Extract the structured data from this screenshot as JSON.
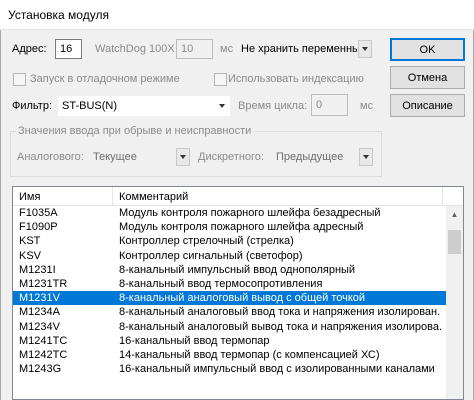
{
  "window": {
    "title": "Установка модуля"
  },
  "address": {
    "label": "Адрес:",
    "value": "16"
  },
  "watchdog": {
    "label": "WatchDog 100X",
    "value": "10",
    "unit": "мс"
  },
  "storage": {
    "value": "Не хранить переменны"
  },
  "debug": {
    "label": "Запуск в отладочном режиме"
  },
  "indexing": {
    "label": "Использовать индексацию"
  },
  "filter": {
    "label": "Фильтр:",
    "value": "ST-BUS(N)"
  },
  "cycle": {
    "label": "Время цикла:",
    "value": "0",
    "unit": "мс"
  },
  "fault_group": {
    "title": "Значения ввода при обрыве и неисправности",
    "analog_label": "Аналогового:",
    "analog_value": "Текущее",
    "discrete_label": "Дискретного:",
    "discrete_value": "Предыдущее"
  },
  "buttons": {
    "ok": "OK",
    "cancel": "Отмена",
    "description": "Описание"
  },
  "list": {
    "columns": [
      "Имя",
      "Комментарий"
    ],
    "rows": [
      {
        "name": "F1035A",
        "comment": "Модуль контроля пожарного шлейфа безадресный"
      },
      {
        "name": "F1090P",
        "comment": "Модуль контроля пожарного шлейфа адресный"
      },
      {
        "name": "KST",
        "comment": "Контроллер стрелочный (стрелка)"
      },
      {
        "name": "KSV",
        "comment": "Контроллер сигнальный (светофор)"
      },
      {
        "name": "M1231I",
        "comment": "8-канальный импульсный ввод однополярный"
      },
      {
        "name": "M1231TR",
        "comment": "8-канальный ввод термосопротивления"
      },
      {
        "name": "M1231V",
        "comment": "8-канальный аналоговый вывод с общей точкой"
      },
      {
        "name": "M1234A",
        "comment": "8-канальный аналоговый ввод тока и напряжения изолирован."
      },
      {
        "name": "M1234V",
        "comment": "8-канальный аналоговый вывод тока и напряжения изолирова."
      },
      {
        "name": "M1241TC",
        "comment": "16-канальный ввод термопар"
      },
      {
        "name": "M1242TC",
        "comment": "14-канальный ввод термопар (с компенсацией ХС)"
      },
      {
        "name": "M1243G",
        "comment": "16-канальный импульсный ввод с изолированными каналами"
      }
    ],
    "selected_index": 6
  }
}
